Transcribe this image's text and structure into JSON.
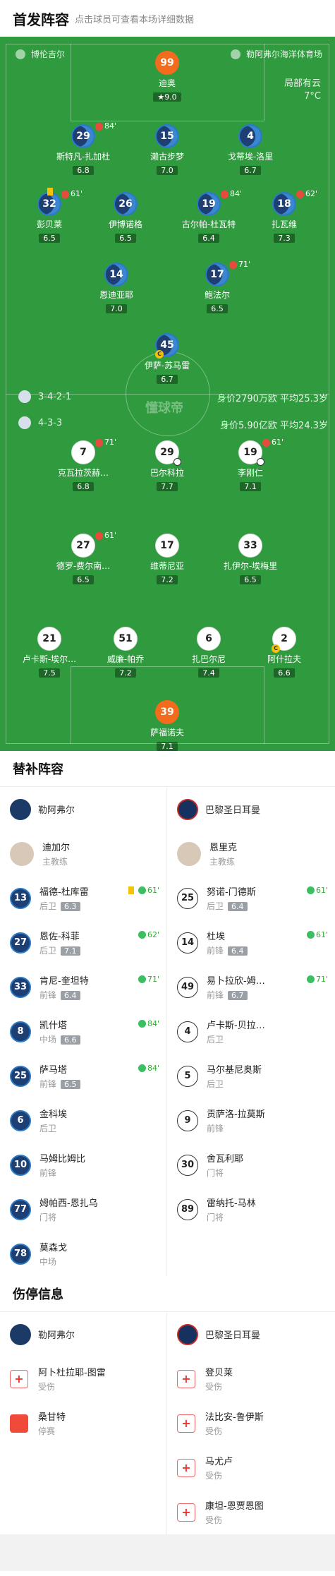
{
  "header": {
    "title": "首发阵容",
    "subtitle": "点击球员可查看本场详细数据"
  },
  "pitch": {
    "home_team": "博伦吉尔",
    "venue": "勒阿弗尔海洋体育场",
    "weather": "局部有云",
    "temperature": "7°C",
    "watermark": "懂球帝",
    "home_formation": "3-4-2-1",
    "home_value": "身价2790万欧 平均25.3岁",
    "away_formation": "4-3-3",
    "away_value": "身价5.90亿欧 平均24.3岁"
  },
  "home_players": [
    {
      "num": "99",
      "name": "迪奥",
      "rating": "9.0",
      "style": "o"
    },
    {
      "num": "29",
      "name": "斯特凡-扎加杜",
      "rating": "6.8",
      "sub": "84'"
    },
    {
      "num": "15",
      "name": "濑古步梦",
      "rating": "7.0"
    },
    {
      "num": "4",
      "name": "戈蒂埃-洛里",
      "rating": "6.7"
    },
    {
      "num": "32",
      "name": "彭贝莱",
      "rating": "6.5",
      "sub": "61'"
    },
    {
      "num": "26",
      "name": "伊博诺格",
      "rating": "6.5"
    },
    {
      "num": "19",
      "name": "古尔帕-杜瓦特",
      "rating": "6.4",
      "sub": "84'"
    },
    {
      "num": "18",
      "name": "扎瓦维",
      "rating": "7.3",
      "sub": "62'"
    },
    {
      "num": "14",
      "name": "恩迪亚耶",
      "rating": "7.0"
    },
    {
      "num": "17",
      "name": "鲍法尔",
      "rating": "6.5",
      "sub": "71'"
    },
    {
      "num": "45",
      "name": "伊萨-苏马雷",
      "rating": "6.7"
    }
  ],
  "away_players": [
    {
      "num": "7",
      "name": "克瓦拉茨赫…",
      "rating": "6.8",
      "sub": "71'"
    },
    {
      "num": "29",
      "name": "巴尔科拉",
      "rating": "7.7"
    },
    {
      "num": "19",
      "name": "李刚仁",
      "rating": "7.1",
      "sub": "61'"
    },
    {
      "num": "27",
      "name": "德罗-费尔南…",
      "rating": "6.5",
      "sub": "61'"
    },
    {
      "num": "17",
      "name": "维蒂尼亚",
      "rating": "7.2"
    },
    {
      "num": "33",
      "name": "扎伊尔-埃梅里",
      "rating": "6.5"
    },
    {
      "num": "21",
      "name": "卢卡斯-埃尔…",
      "rating": "7.5"
    },
    {
      "num": "51",
      "name": "威廉-帕乔",
      "rating": "7.2"
    },
    {
      "num": "6",
      "name": "扎巴尔尼",
      "rating": "7.4"
    },
    {
      "num": "2",
      "name": "阿什拉夫",
      "rating": "6.6"
    },
    {
      "num": "39",
      "name": "萨福诺夫",
      "rating": "7.1",
      "style": "o"
    }
  ],
  "subs_title": "替补阵容",
  "subs": {
    "home_team": "勒阿弗尔",
    "away_team": "巴黎圣日耳曼",
    "home_coach": {
      "name": "迪加尔",
      "role": "主教练"
    },
    "away_coach": {
      "name": "恩里克",
      "role": "主教练"
    },
    "home": [
      {
        "num": "13",
        "name": "福德-杜库雷",
        "pos": "后卫",
        "rating": "6.3",
        "in": "61'"
      },
      {
        "num": "27",
        "name": "恩佐-科菲",
        "pos": "后卫",
        "rating": "7.1",
        "in": "62'"
      },
      {
        "num": "33",
        "name": "肯尼-奎坦特",
        "pos": "前锋",
        "rating": "6.4",
        "in": "71'"
      },
      {
        "num": "8",
        "name": "凯什塔",
        "pos": "中场",
        "rating": "6.6",
        "in": "84'"
      },
      {
        "num": "25",
        "name": "萨马塔",
        "pos": "前锋",
        "rating": "6.5",
        "in": "84'"
      },
      {
        "num": "6",
        "name": "金科埃",
        "pos": "后卫",
        "rating": "",
        "in": ""
      },
      {
        "num": "10",
        "name": "马姆比姆比",
        "pos": "前锋",
        "rating": "",
        "in": ""
      },
      {
        "num": "77",
        "name": "姆帕西-恩扎乌",
        "pos": "门将",
        "rating": "",
        "in": ""
      },
      {
        "num": "78",
        "name": "莫森戈",
        "pos": "中场",
        "rating": "",
        "in": ""
      }
    ],
    "away": [
      {
        "num": "25",
        "name": "努诺-门德斯",
        "pos": "后卫",
        "rating": "6.4",
        "in": "61'"
      },
      {
        "num": "14",
        "name": "杜埃",
        "pos": "前锋",
        "rating": "6.4",
        "in": "61'"
      },
      {
        "num": "49",
        "name": "易卜拉欣-姆…",
        "pos": "前锋",
        "rating": "6.7",
        "in": "71'"
      },
      {
        "num": "4",
        "name": "卢卡斯-贝拉…",
        "pos": "后卫",
        "rating": "",
        "in": ""
      },
      {
        "num": "5",
        "name": "马尔基尼奥斯",
        "pos": "后卫",
        "rating": "",
        "in": ""
      },
      {
        "num": "9",
        "name": "贡萨洛-拉莫斯",
        "pos": "前锋",
        "rating": "",
        "in": ""
      },
      {
        "num": "30",
        "name": "舍瓦利耶",
        "pos": "门将",
        "rating": "",
        "in": ""
      },
      {
        "num": "89",
        "name": "雷纳托-马林",
        "pos": "门将",
        "rating": "",
        "in": ""
      }
    ]
  },
  "inj_title": "伤停信息",
  "injuries": {
    "home": [
      {
        "name": "阿卜杜拉耶-图雷",
        "status": "受伤",
        "type": "med"
      },
      {
        "name": "桑甘特",
        "status": "停赛",
        "type": "red"
      }
    ],
    "away": [
      {
        "name": "登贝莱",
        "status": "受伤",
        "type": "med"
      },
      {
        "name": "法比安-鲁伊斯",
        "status": "受伤",
        "type": "med"
      },
      {
        "name": "马尤卢",
        "status": "受伤",
        "type": "med"
      },
      {
        "name": "康坦-恩贾恩图",
        "status": "受伤",
        "type": "med"
      }
    ]
  },
  "colors": {
    "pitch": "#2f9b3e",
    "home_kit": "#1e3f73",
    "keeper": "#f36b1c"
  }
}
